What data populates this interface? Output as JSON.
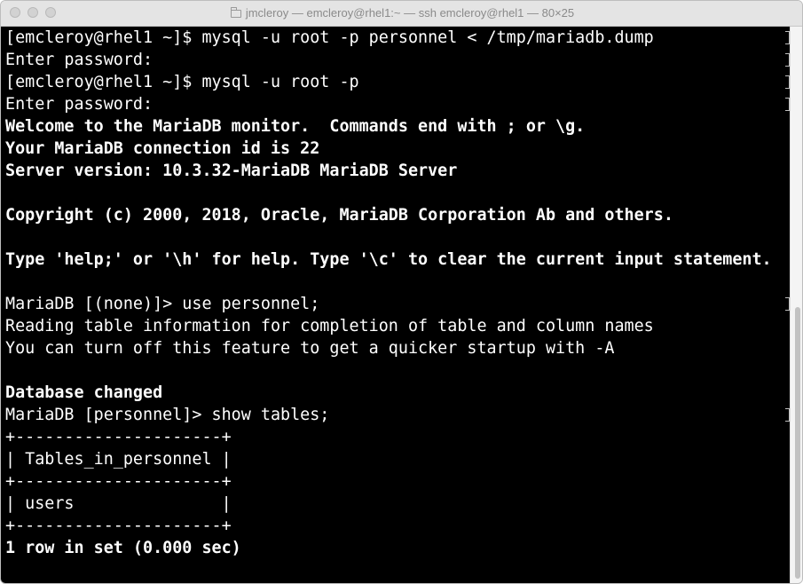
{
  "window": {
    "title": "jmcleroy — emcleroy@rhel1:~ — ssh emcleroy@rhel1 — 80×25",
    "buttons": [
      "close",
      "minimize",
      "zoom"
    ]
  },
  "terminal": {
    "lines": [
      {
        "text": "[emcleroy@rhel1 ~]$ mysql -u root -p personnel < /tmp/mariadb.dump",
        "bold": false
      },
      {
        "text": "Enter password:",
        "bold": false
      },
      {
        "text": "[emcleroy@rhel1 ~]$ mysql -u root -p",
        "bold": false
      },
      {
        "text": "Enter password:",
        "bold": false
      },
      {
        "text": "Welcome to the MariaDB monitor.  Commands end with ; or \\g.",
        "bold": true
      },
      {
        "text": "Your MariaDB connection id is 22",
        "bold": true
      },
      {
        "text": "Server version: 10.3.32-MariaDB MariaDB Server",
        "bold": true
      },
      {
        "text": "",
        "bold": false
      },
      {
        "text": "Copyright (c) 2000, 2018, Oracle, MariaDB Corporation Ab and others.",
        "bold": true
      },
      {
        "text": "",
        "bold": false
      },
      {
        "text": "Type 'help;' or '\\h' for help. Type '\\c' to clear the current input statement.",
        "bold": true
      },
      {
        "text": "",
        "bold": false
      },
      {
        "text": "MariaDB [(none)]> use personnel;",
        "bold": false
      },
      {
        "text": "Reading table information for completion of table and column names",
        "bold": false
      },
      {
        "text": "You can turn off this feature to get a quicker startup with -A",
        "bold": false
      },
      {
        "text": "",
        "bold": false
      },
      {
        "text": "Database changed",
        "bold": true
      },
      {
        "text": "MariaDB [personnel]> show tables;",
        "bold": false
      },
      {
        "text": "+---------------------+",
        "bold": false
      },
      {
        "text": "| Tables_in_personnel |",
        "bold": false
      },
      {
        "text": "+---------------------+",
        "bold": false
      },
      {
        "text": "| users               |",
        "bold": false
      },
      {
        "text": "+---------------------+",
        "bold": false
      },
      {
        "text": "1 row in set (0.000 sec)",
        "bold": true
      },
      {
        "text": "",
        "bold": false
      }
    ],
    "marked_lines": [
      0,
      1,
      2,
      3,
      12,
      17
    ],
    "background": "#000000",
    "foreground": "#ffffff"
  }
}
